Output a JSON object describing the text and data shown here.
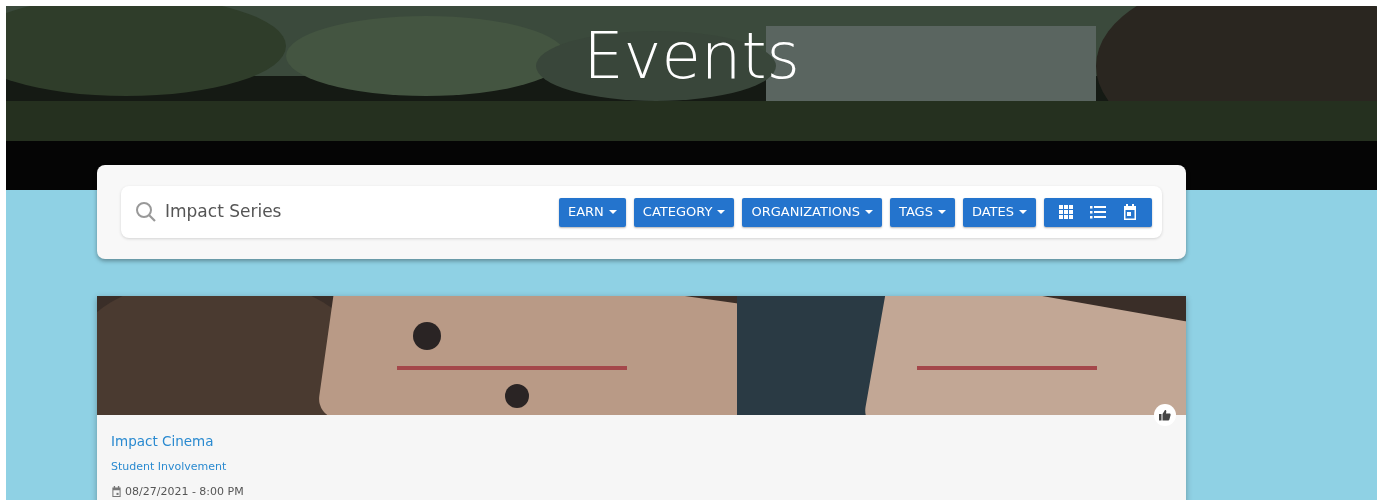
{
  "hero": {
    "title": "Events"
  },
  "search": {
    "value": "Impact Series"
  },
  "filters": [
    {
      "label": "EARN"
    },
    {
      "label": "CATEGORY"
    },
    {
      "label": "ORGANIZATIONS"
    },
    {
      "label": "TAGS"
    },
    {
      "label": "DATES"
    }
  ],
  "view_buttons": [
    {
      "kind": "grid"
    },
    {
      "kind": "list"
    },
    {
      "kind": "calendar"
    }
  ],
  "events": [
    {
      "title": "Impact Cinema",
      "organization": "Student Involvement",
      "datetime": "08/27/2021 - 8:00 PM"
    }
  ]
}
